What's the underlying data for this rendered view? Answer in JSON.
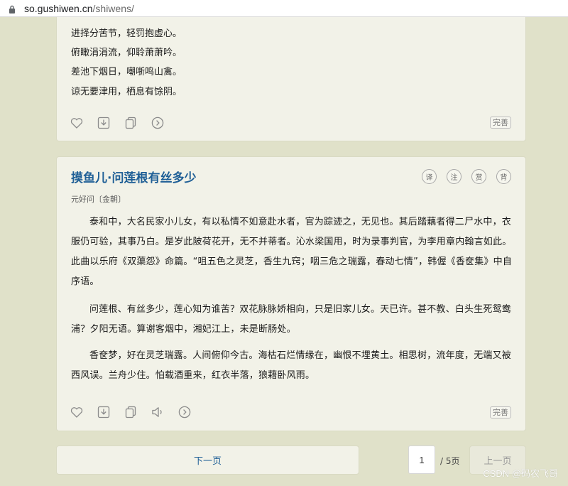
{
  "browser": {
    "url_host": "so.gushiwen.cn",
    "url_path": "/shiwens/"
  },
  "card1": {
    "lines": [
      "进择分苦节，轻罚抱虚心。",
      "俯瞰涓涓流，仰聆萧萧吟。",
      "差池下烟日，嘲哳鸣山禽。",
      "谅无要津用，栖息有馀阴。"
    ],
    "perfect_label": "完善"
  },
  "card2": {
    "title": "摸鱼儿·问莲根有丝多少",
    "author": "元好问〔金朝〕",
    "circle_buttons": [
      "译",
      "注",
      "赏",
      "背"
    ],
    "paragraphs": [
      "泰和中，大名民家小儿女，有以私情不如意赴水者，官为踪迹之，无见也。其后踏藕者得二尸水中，衣服仍可验，其事乃白。是岁此陂荷花开，无不并蒂者。沁水梁国用，时为录事判官，为李用章内翰言如此。此曲以乐府《双蕖怨》命篇。“咀五色之灵芝，香生九窍；咽三危之瑞露，春动七情”，韩偓《香奁集》中自序语。",
      "问莲根、有丝多少，莲心知为谁苦？双花脉脉娇相向，只是旧家儿女。天已许。甚不教、白头生死鸳鸯浦？夕阳无语。算谢客烟中，湘妃江上，未是断肠处。",
      "香奁梦，好在灵芝瑞露。人间俯仰今古。海枯石烂情缘在，幽恨不埋黄土。相思树，流年度，无端又被西风误。兰舟少住。怕载酒重来，红衣半落，狼藉卧风雨。"
    ],
    "perfect_label": "完善"
  },
  "pagination": {
    "next_label": "下一页",
    "current_page": "1",
    "total_label": "/ 5页",
    "prev_label": "上一页"
  },
  "watermark": "CSDN @码农飞哥",
  "colors": {
    "background": "#e0e1c9",
    "card": "#f2f2e8",
    "title": "#1f5f96",
    "icon": "#8a8a8a"
  }
}
